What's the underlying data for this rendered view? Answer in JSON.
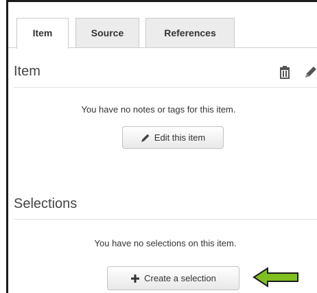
{
  "tabs": [
    {
      "label": "Item",
      "active": true
    },
    {
      "label": "Source",
      "active": false
    },
    {
      "label": "References",
      "active": false
    }
  ],
  "item_section": {
    "title": "Item",
    "message": "You have no notes or tags for this item.",
    "edit_button_label": "Edit this item",
    "icons": [
      "trash-icon",
      "pencil-icon"
    ]
  },
  "selections_section": {
    "title": "Selections",
    "message": "You have no selections on this item.",
    "create_button_label": "Create a selection",
    "icons": [
      "plus-icon",
      "green-arrow-icon"
    ]
  },
  "colors": {
    "arrow_fill": "#7fbf1f",
    "tab_inactive_bg": "#ececec",
    "text": "#333333"
  }
}
